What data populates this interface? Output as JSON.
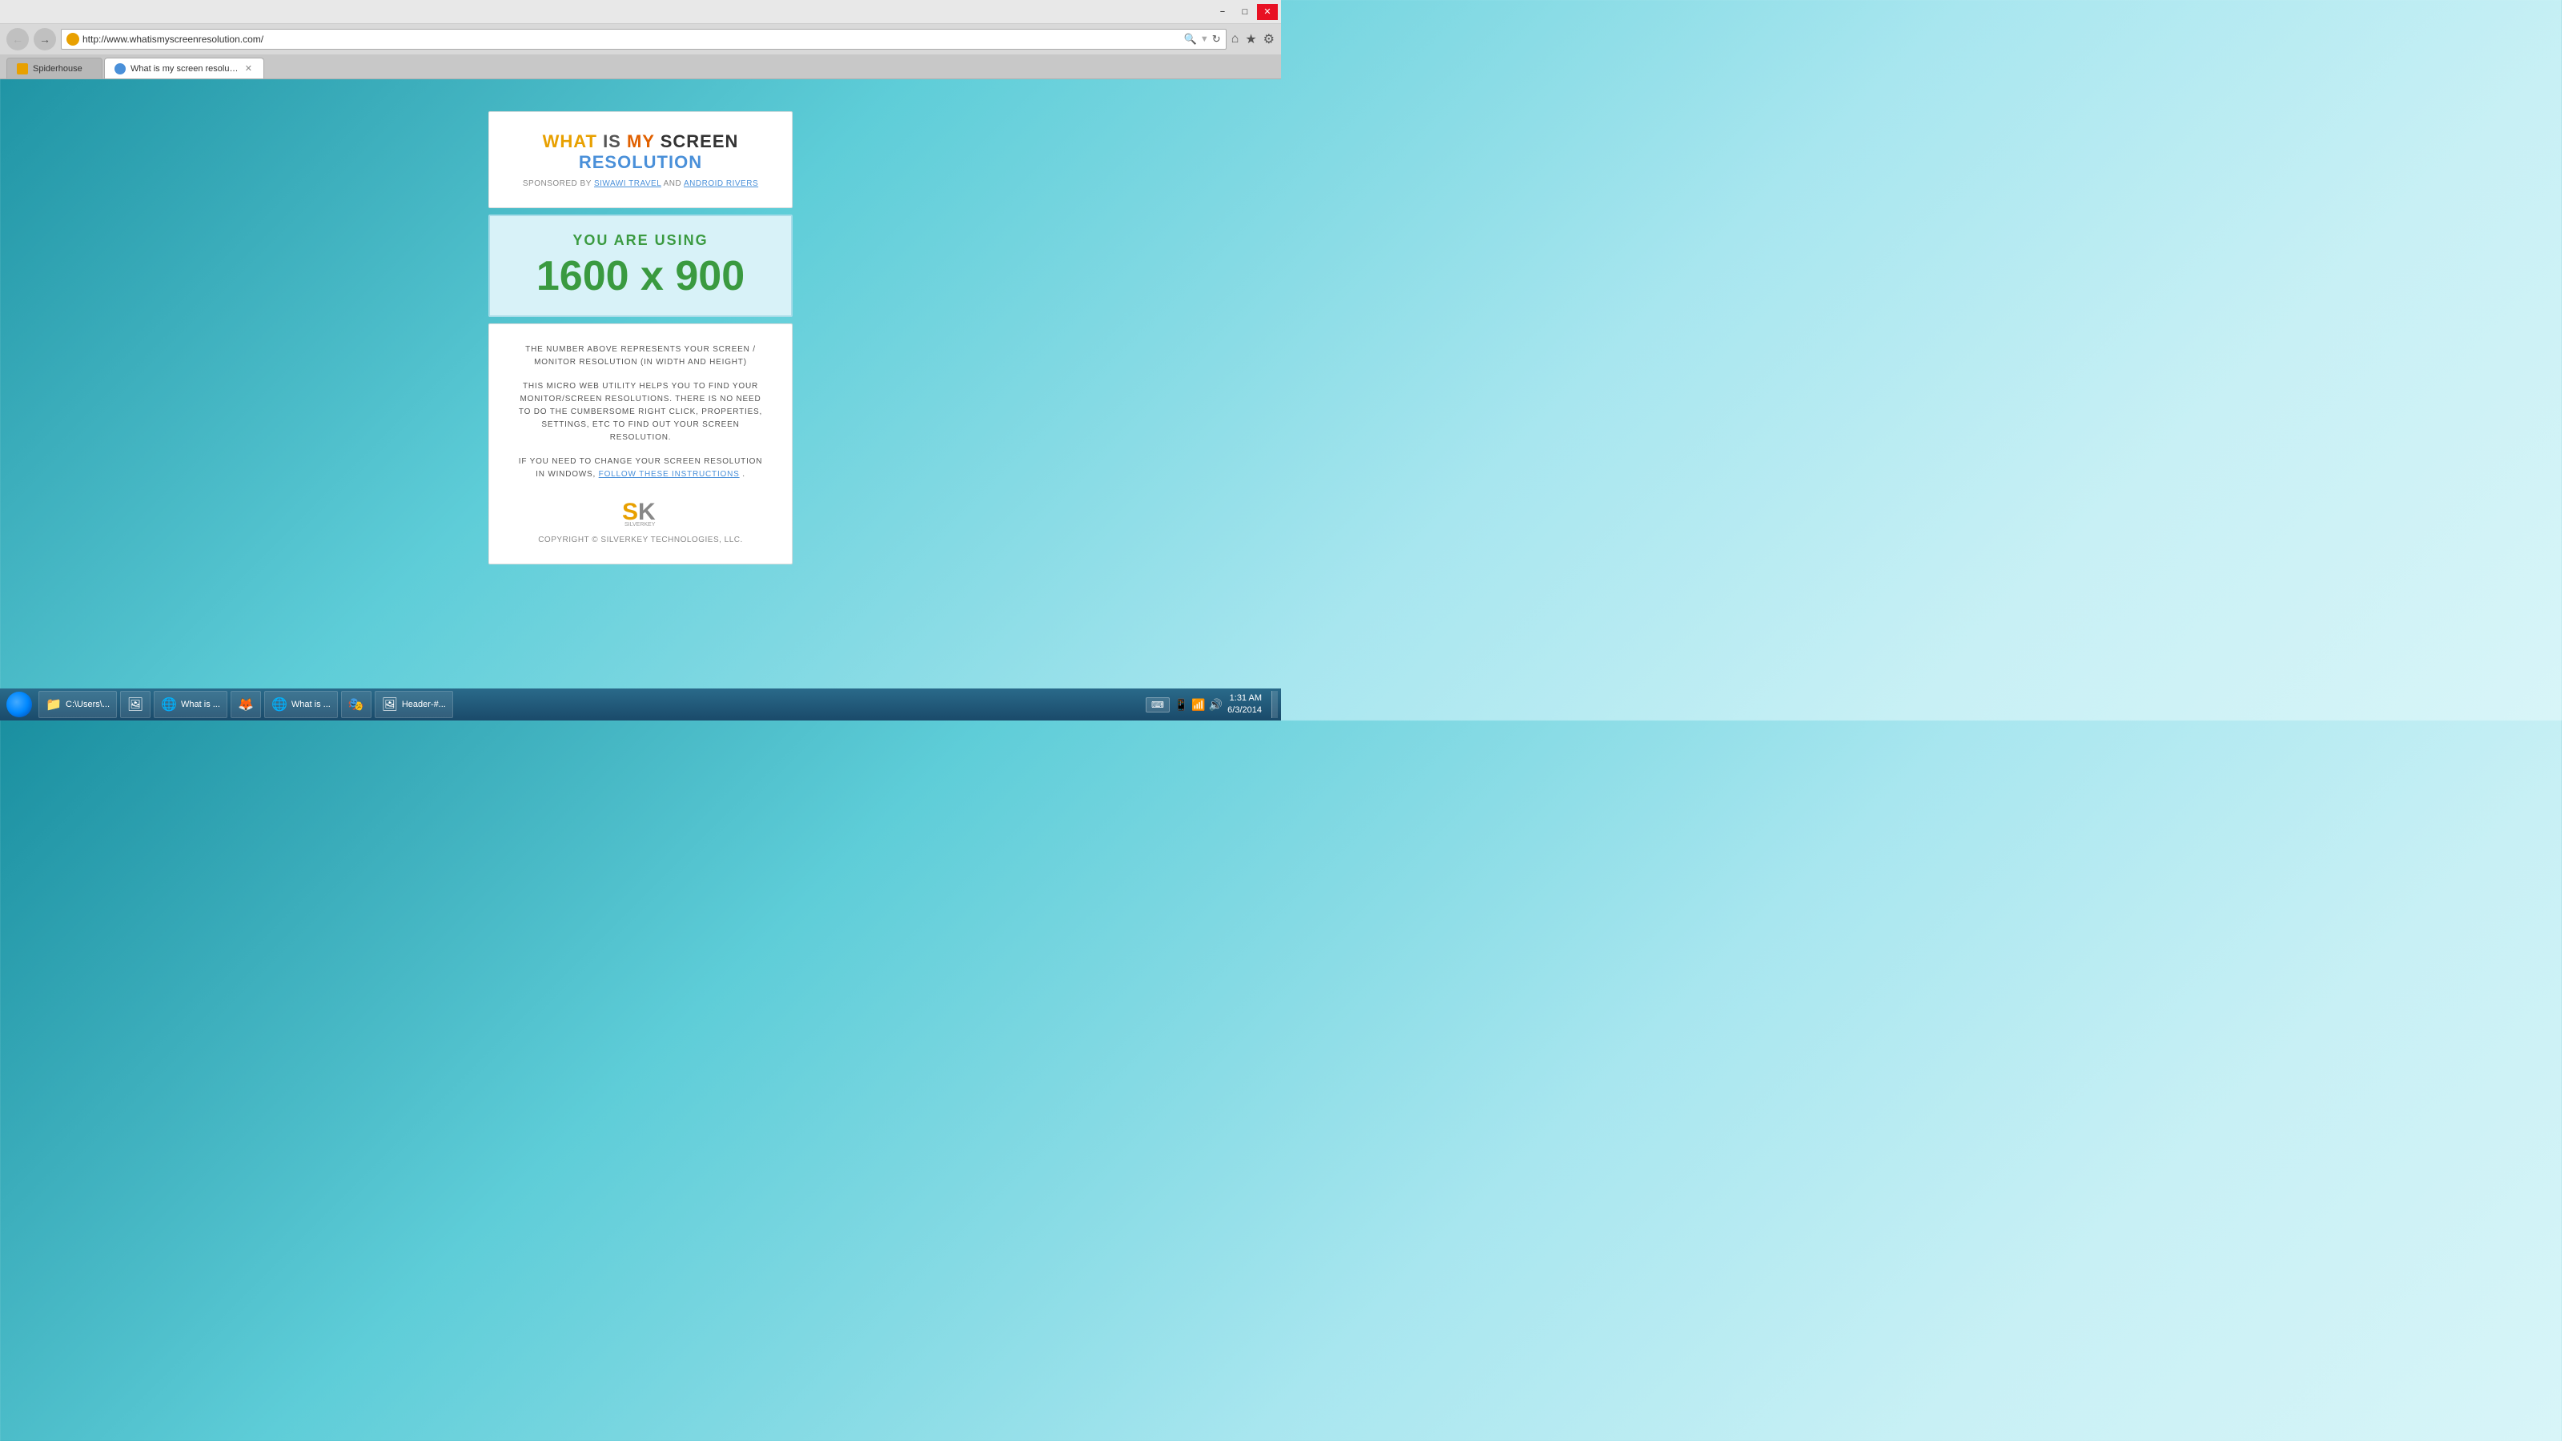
{
  "titlebar": {
    "minimize_label": "−",
    "maximize_label": "□",
    "close_label": "✕"
  },
  "navbar": {
    "back_icon": "←",
    "forward_icon": "→",
    "address": "http://www.whatismyscreenresolution.com/",
    "search_icon": "🔍",
    "refresh_icon": "↻",
    "home_icon": "⌂",
    "favorites_icon": "★",
    "tools_icon": "⚙"
  },
  "tabs": [
    {
      "label": "Spiderhouse",
      "active": false,
      "favicon_color": "#e8a000"
    },
    {
      "label": "What is my screen resolution",
      "active": true,
      "favicon_color": "#4a90d9"
    }
  ],
  "page": {
    "title": {
      "what": "WHAT",
      "is": "IS",
      "my": "MY",
      "screen": "SCREEN",
      "resolution": "RESOLUTION"
    },
    "sponsored_prefix": "SPONSORED BY",
    "sponsor1": "SIWAWI TRAVEL",
    "sponsored_and": "AND",
    "sponsor2": "ANDROID RIVERS",
    "you_are_using": "YOU ARE USING",
    "resolution": "1600 x 900",
    "info1": "THE NUMBER ABOVE REPRESENTS YOUR SCREEN / MONITOR RESOLUTION (IN WIDTH AND HEIGHT)",
    "info2": "THIS MICRO WEB UTILITY HELPS YOU TO FIND YOUR MONITOR/SCREEN RESOLUTIONS. THERE IS NO NEED TO DO THE CUMBERSOME RIGHT CLICK, PROPERTIES, SETTINGS, ETC TO FIND OUT YOUR SCREEN RESOLUTION.",
    "info3_prefix": "IF YOU NEED TO CHANGE YOUR SCREEN RESOLUTION IN WINDOWS,",
    "info3_link": "FOLLOW THESE INSTRUCTIONS",
    "info3_suffix": ".",
    "copyright": "COPYRIGHT © SILVERKEY TECHNOLOGIES, LLC."
  },
  "taskbar": {
    "items": [
      {
        "label": "C:\\Users\\...",
        "icon": "📁",
        "active": false
      },
      {
        "label": "",
        "icon": "🖼",
        "active": false
      },
      {
        "label": "What is ...",
        "icon": "🌐",
        "active": false
      },
      {
        "label": "",
        "icon": "🦊",
        "active": false
      },
      {
        "label": "What is ...",
        "icon": "🌐",
        "active": false
      },
      {
        "label": "",
        "icon": "🎭",
        "active": false
      },
      {
        "label": "Header-#...",
        "icon": "🖼",
        "active": false
      }
    ],
    "clock_time": "1:31 AM",
    "clock_date": "6/3/2014",
    "keyboard_label": "⌨"
  }
}
